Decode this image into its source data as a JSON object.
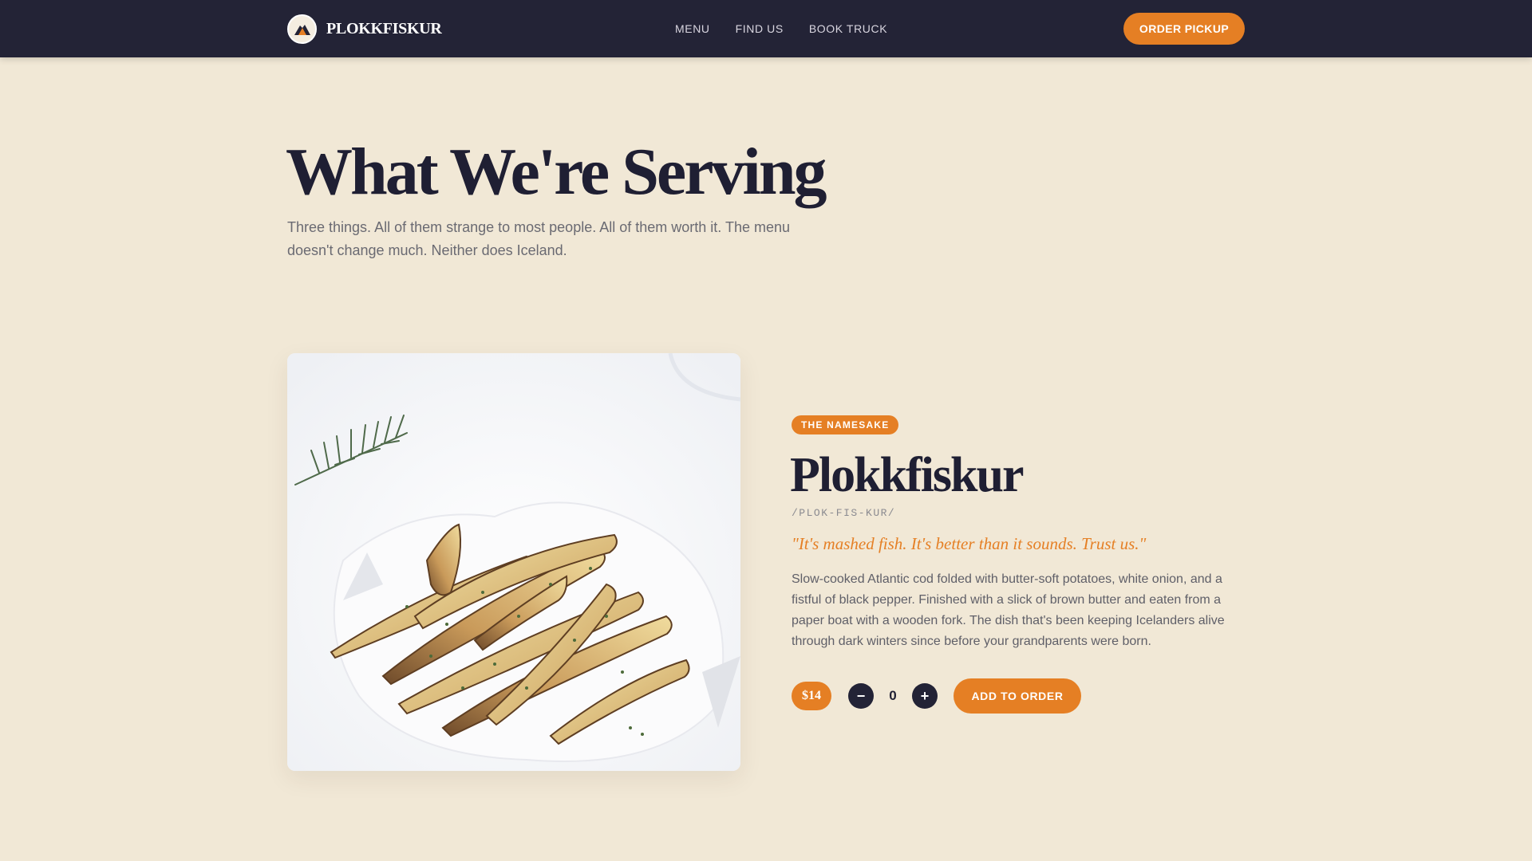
{
  "nav": {
    "brand_name": "PLOKKFISKUR",
    "logo_icon": "volcano-logo-icon",
    "links": [
      "MENU",
      "FIND US",
      "BOOK TRUCK"
    ],
    "cta_label": "ORDER PICKUP"
  },
  "hero": {
    "title": "What We're Serving",
    "subtitle": "Three things. All of them strange to most people. All of them worth it. The menu doesn't change much. Neither does Iceland."
  },
  "item": {
    "image_alt": "Roasted potato wedges with herbs on white parchment",
    "badge": "THE NAMESAKE",
    "name": "Plokkfiskur",
    "pronunciation": "/PLOK-FIS-KUR/",
    "quote": "\"It's mashed fish. It's better than it sounds. Trust us.\"",
    "description": "Slow-cooked Atlantic cod folded with butter-soft potatoes, white onion, and a fistful of black pepper. Finished with a slick of brown butter and eaten from a paper boat with a wooden fork. The dish that's been keeping Icelanders alive through dark winters since before your grandparents were born.",
    "price": "$14",
    "quantity": "0",
    "minus_symbol": "−",
    "plus_symbol": "+",
    "add_label": "ADD TO ORDER"
  },
  "colors": {
    "nav_bg": "#232336",
    "page_bg": "#f1e8d6",
    "accent": "#e57f24",
    "heading": "#1f1f33"
  }
}
